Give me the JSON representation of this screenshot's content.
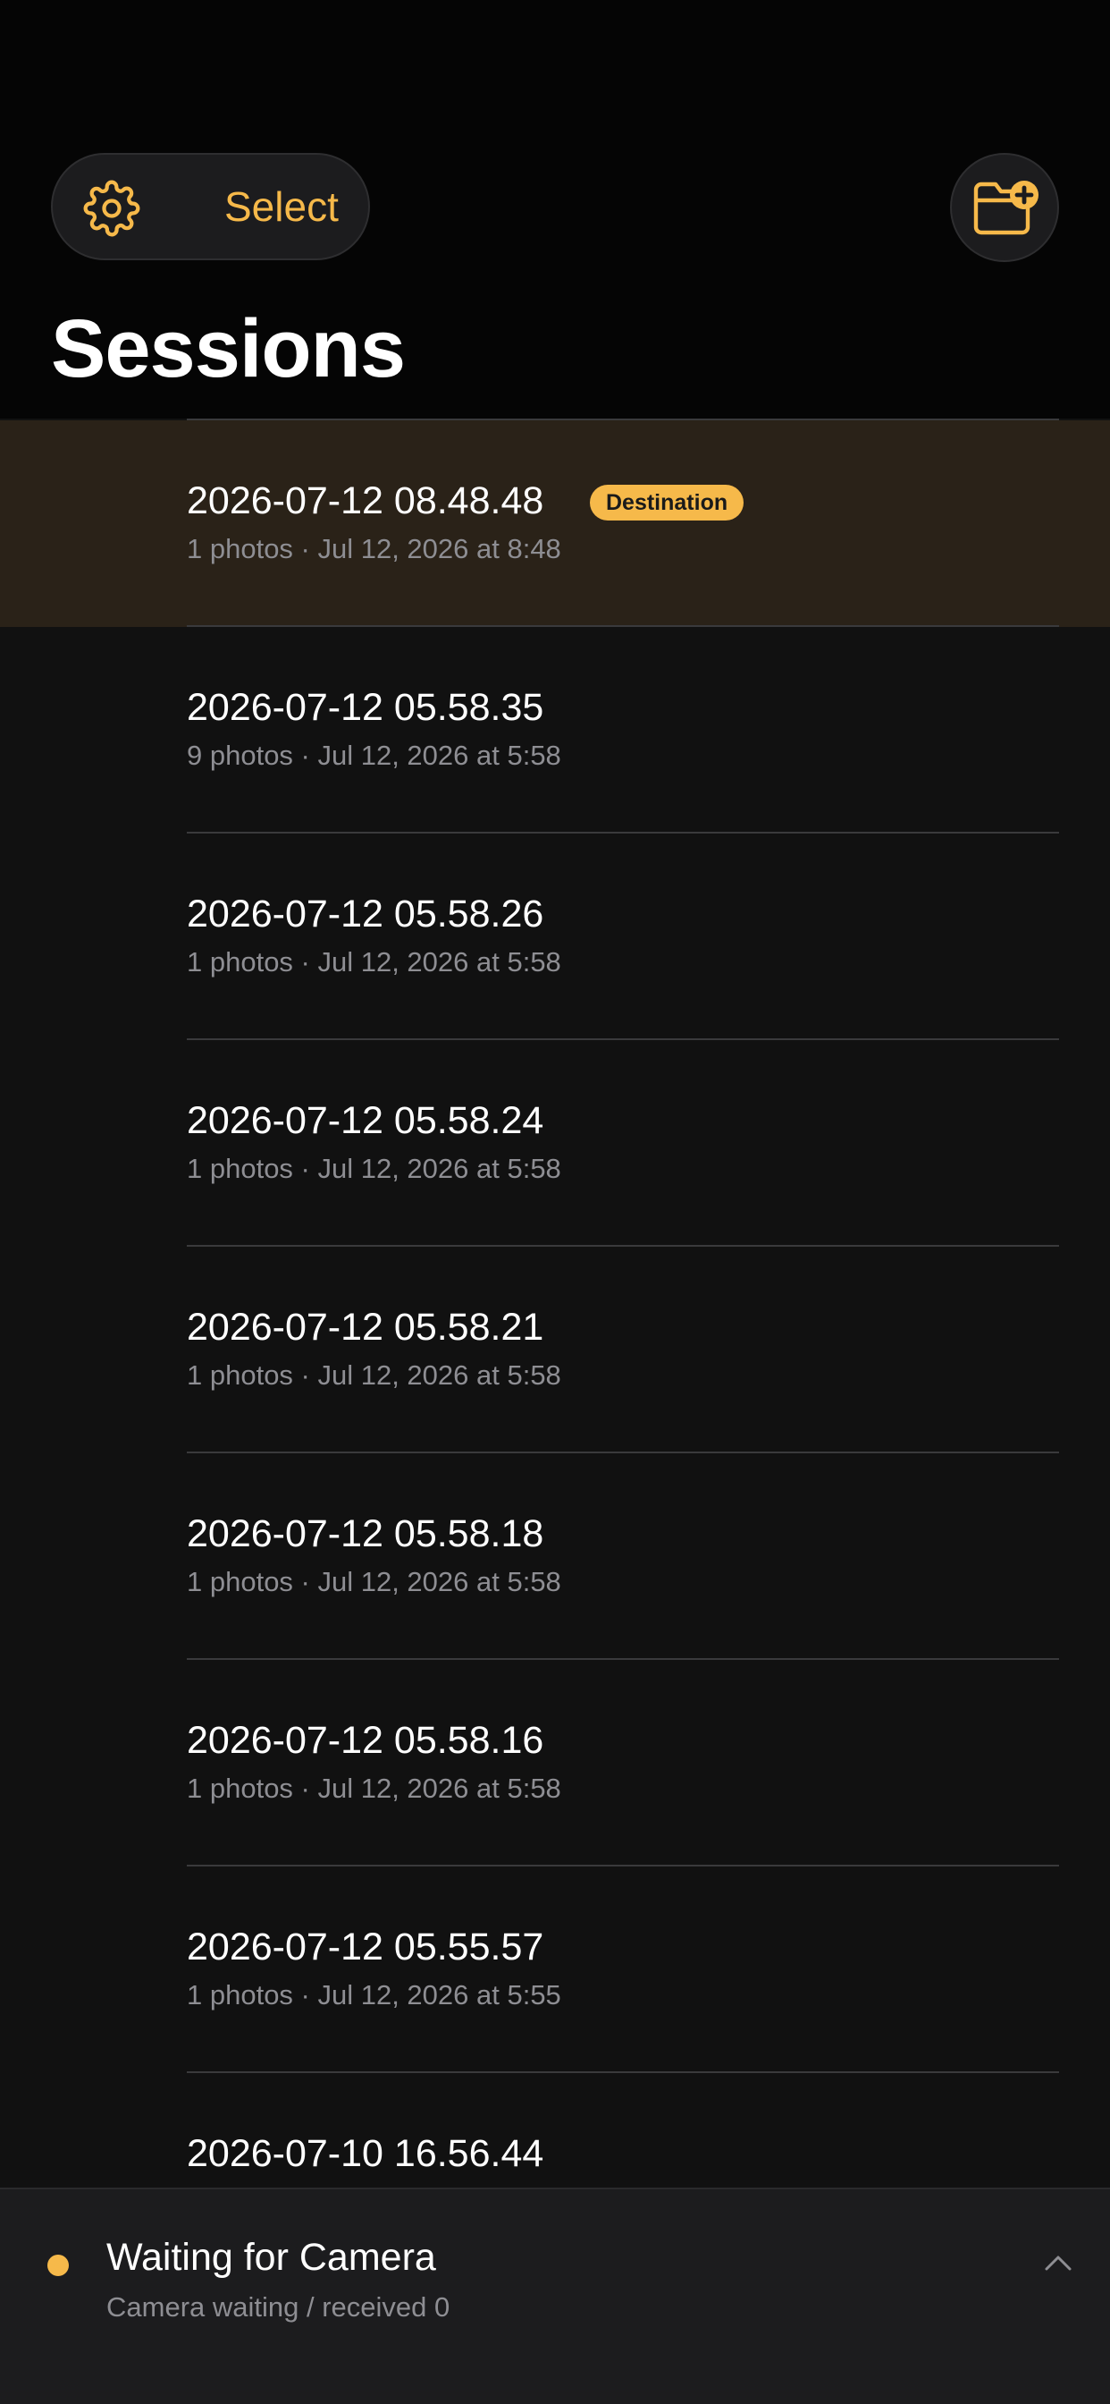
{
  "header": {
    "select_label": "Select",
    "title": "Sessions"
  },
  "sessions": [
    {
      "name": "2026-07-12 08.48.48",
      "meta": "1 photos · Jul 12, 2026 at 8:48",
      "badge": "Destination",
      "active": true,
      "thumb_colors": [
        "#3a3a3a",
        "#1a1a1a",
        "#c9c2b6"
      ]
    },
    {
      "name": "2026-07-12 05.58.35",
      "meta": "9 photos · Jul 12, 2026 at 5:58",
      "thumb_colors": [
        "#6c8aa8",
        "#d8c9b0",
        "#b9a88e"
      ]
    },
    {
      "name": "2026-07-12 05.58.26",
      "meta": "1 photos · Jul 12, 2026 at 5:58",
      "thumb_colors": [
        "#8a7b6e",
        "#e6dccd",
        "#1c1c1c"
      ]
    },
    {
      "name": "2026-07-12 05.58.24",
      "meta": "1 photos · Jul 12, 2026 at 5:58",
      "thumb_colors": [
        "#b58652",
        "#222222",
        "#6b4f38"
      ]
    },
    {
      "name": "2026-07-12 05.58.21",
      "meta": "1 photos · Jul 12, 2026 at 5:58",
      "thumb_colors": [
        "#8d8478",
        "#2b2b2b",
        "#d9d1c4"
      ]
    },
    {
      "name": "2026-07-12 05.58.18",
      "meta": "1 photos · Jul 12, 2026 at 5:58",
      "thumb_colors": [
        "#5a4536",
        "#efe7da",
        "#7a6252"
      ]
    },
    {
      "name": "2026-07-12 05.58.16",
      "meta": "1 photos · Jul 12, 2026 at 5:58",
      "thumb_colors": [
        "#e8e4dd",
        "#2f2f2f",
        "#151515"
      ]
    },
    {
      "name": "2026-07-12 05.55.57",
      "meta": "1 photos · Jul 12, 2026 at 5:55",
      "thumb_colors": [
        "#f2efea",
        "#dcd4c8",
        "#cfc6b8"
      ]
    },
    {
      "name": "2026-07-10 16.56.44",
      "meta": "",
      "thumb_colors": [
        "#3d5a2e",
        "#6d8a4f",
        "#f1e8de"
      ]
    }
  ],
  "status_bar": {
    "title": "Waiting for Camera",
    "subtitle": "Camera waiting / received 0",
    "dot_color": "#f6b94a"
  },
  "colors": {
    "accent": "#f6b94a",
    "background": "#111111",
    "active_row": "#2a2218"
  },
  "icons": {
    "settings": "gear-icon",
    "new_folder": "folder-plus-icon",
    "expand": "chevron-up-icon"
  }
}
